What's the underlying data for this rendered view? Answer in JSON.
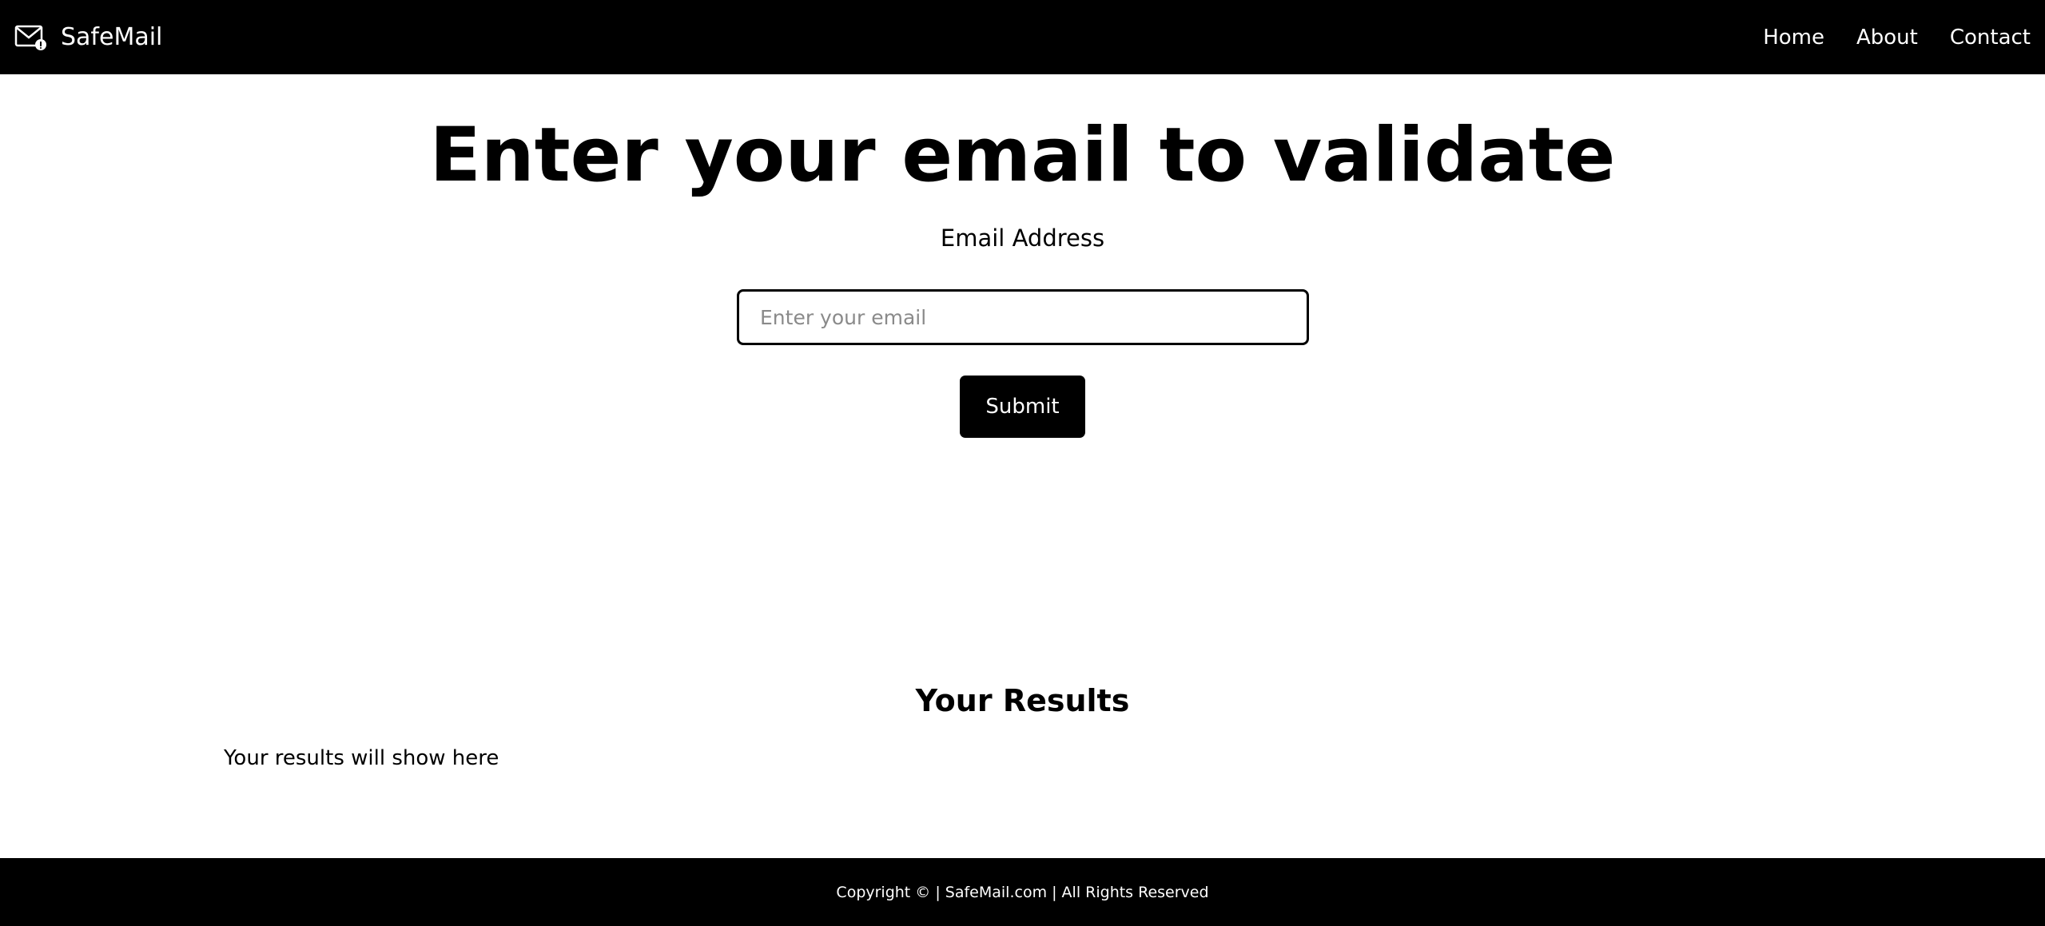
{
  "navbar": {
    "brand_name": "SafeMail",
    "brand_icon": "envelope-badge-icon",
    "links": [
      {
        "label": "Home"
      },
      {
        "label": "About"
      },
      {
        "label": "Contact"
      }
    ]
  },
  "hero": {
    "title": "Enter your email to validate",
    "email_label": "Email Address",
    "email_placeholder": "Enter your email",
    "email_value": "",
    "submit_label": "Submit"
  },
  "results": {
    "title": "Your Results",
    "text": "Your results will show here"
  },
  "footer": {
    "text": "Copyright © | SafeMail.com | All Rights Reserved"
  },
  "colors": {
    "navbar_bg": "#000000",
    "footer_bg": "#000000",
    "button_bg": "#000000",
    "page_bg": "#ffffff"
  }
}
